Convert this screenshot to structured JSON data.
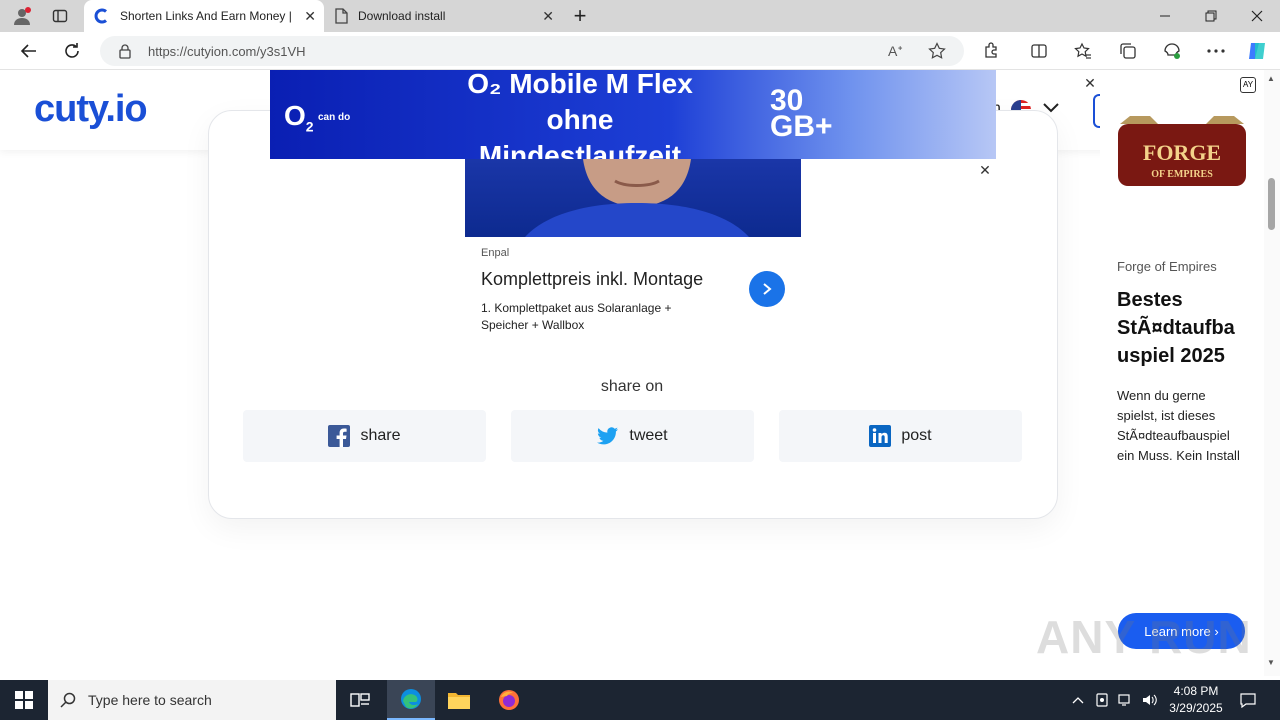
{
  "browser": {
    "tabs": [
      {
        "title": "Shorten Links And Earn Money | ",
        "active": true
      },
      {
        "title": "Download install",
        "active": false
      }
    ],
    "url": "https://cutyion.com/y3s1VH",
    "new_tab_glyph": "+",
    "close_glyph": "✕"
  },
  "site": {
    "logo": "cuty.io",
    "header_partial": "n"
  },
  "top_ad": {
    "brand": "O",
    "brand_sub": "2",
    "tagline": "can do",
    "headline_1": "O₂ Mobile M Flex",
    "headline_2": "ohne",
    "headline_3": "Mindestlaufzeit",
    "gb_line_1": "30",
    "gb_line_2": "GB+"
  },
  "native_ad": {
    "source": "Enpal",
    "title": "Komplettpreis inkl. Montage",
    "desc_line_1": "1. Komplettpaket aus Solaranlage +",
    "desc_line_2": "Speicher + Wallbox"
  },
  "share": {
    "heading": "share on",
    "buttons": [
      {
        "label": "share",
        "icon": "facebook-icon"
      },
      {
        "label": "tweet",
        "icon": "twitter-icon"
      },
      {
        "label": "post",
        "icon": "linkedin-icon"
      }
    ]
  },
  "side_ad": {
    "logo_line_1": "FORGE",
    "logo_line_2": "OF EMPIRES",
    "advertiser": "Forge of Empires",
    "title_1": "Bestes",
    "title_2": "StÃ¤dtaufba",
    "title_3": "uspiel 2025",
    "body_1": "Wenn du gerne",
    "body_2": "spielst, ist dieses",
    "body_3": "StÃ¤dteaufbauspiel",
    "body_4": "ein Muss. Kein Install",
    "cta": "Learn more"
  },
  "watermark": "ANY RUN",
  "taskbar": {
    "search_placeholder": "Type here to search",
    "time": "4:08 PM",
    "date": "3/29/2025"
  },
  "colors": {
    "brand_blue": "#1a4fd6",
    "facebook": "#3b5998",
    "twitter": "#1da1f2",
    "linkedin": "#0a66c2"
  }
}
